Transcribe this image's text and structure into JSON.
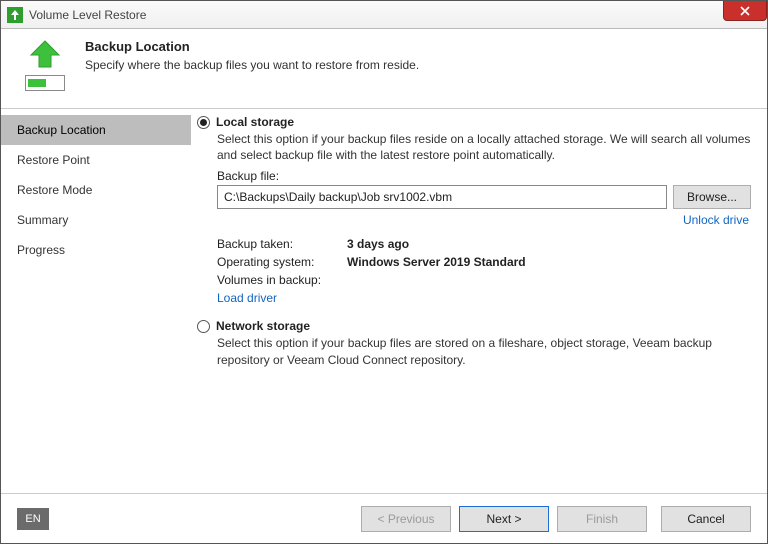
{
  "window": {
    "title": "Volume Level Restore"
  },
  "header": {
    "title": "Backup Location",
    "subtitle": "Specify where the backup files you want to restore from reside."
  },
  "sidebar": {
    "items": [
      {
        "label": "Backup Location",
        "active": true
      },
      {
        "label": "Restore Point",
        "active": false
      },
      {
        "label": "Restore Mode",
        "active": false
      },
      {
        "label": "Summary",
        "active": false
      },
      {
        "label": "Progress",
        "active": false
      }
    ]
  },
  "content": {
    "local": {
      "selected": true,
      "title": "Local storage",
      "description": "Select this option if your backup files reside on a locally attached storage. We will search all volumes and select backup file with the latest restore point automatically.",
      "backup_file_label": "Backup file:",
      "backup_file_value": "C:\\Backups\\Daily backup\\Job srv1002.vbm",
      "browse_label": "Browse...",
      "unlock_label": "Unlock drive",
      "meta": {
        "taken_label": "Backup taken:",
        "taken_value": "3 days ago",
        "os_label": "Operating system:",
        "os_value": "Windows Server 2019 Standard",
        "volumes_label": "Volumes in backup:"
      },
      "load_driver_label": "Load driver"
    },
    "network": {
      "selected": false,
      "title": "Network storage",
      "description": "Select this option if your backup files are stored on a fileshare, object storage, Veeam backup repository or Veeam Cloud Connect repository."
    }
  },
  "footer": {
    "lang": "EN",
    "previous": "< Previous",
    "next": "Next >",
    "finish": "Finish",
    "cancel": "Cancel"
  }
}
